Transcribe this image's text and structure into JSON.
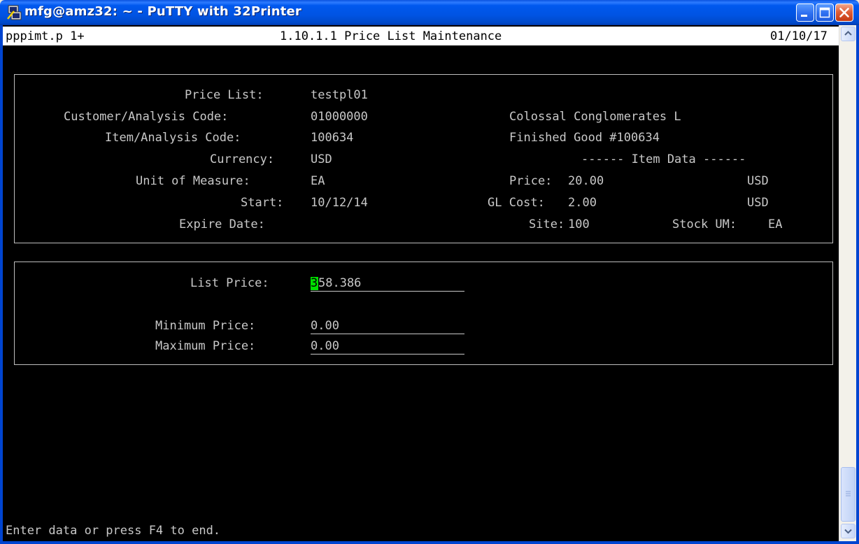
{
  "window": {
    "title": "mfg@amz32: ~ - PuTTY with 32Printer",
    "icon": "putty-icon",
    "controls": [
      "minimize-icon",
      "maximize-icon",
      "close-icon"
    ]
  },
  "header": {
    "program": "pppimt.p 1+",
    "menu_title": "1.10.1.1 Price List Maintenance",
    "date": "01/10/17"
  },
  "top_frame": {
    "fields": [
      {
        "label": "Price List:",
        "value": "testpl01"
      },
      {
        "label": "Customer/Analysis Code:",
        "value": "01000000"
      },
      {
        "label": "Item/Analysis Code:",
        "value": "100634"
      },
      {
        "label": "Currency:",
        "value": "USD"
      },
      {
        "label": "Unit of Measure:",
        "value": "EA"
      },
      {
        "label": "Start:",
        "value": "10/12/14"
      },
      {
        "label": "Expire Date:",
        "value": ""
      }
    ],
    "customer_name": "Colossal Conglomerates L",
    "item_description": "Finished Good #100634",
    "item_data_header": "------ Item Data ------",
    "price": {
      "label": "Price:",
      "value": "20.00",
      "currency": "USD"
    },
    "gl_cost": {
      "label": "GL Cost:",
      "value": "2.00",
      "currency": "USD"
    },
    "site": {
      "label": "Site:",
      "value": "100"
    },
    "stock_um": {
      "label": "Stock UM:",
      "value": "EA"
    }
  },
  "bottom_frame": {
    "list_price": {
      "label": "List Price:",
      "cursor_char": "3",
      "rest": "58.386"
    },
    "minimum_price": {
      "label": "Minimum Price:",
      "value": "0.00"
    },
    "maximum_price": {
      "label": "Maximum Price:",
      "value": "0.00"
    }
  },
  "status_line": "Enter data or press F4 to end.",
  "colors": {
    "terminal_bg": "#000000",
    "terminal_fg": "#C8C8C8",
    "header_bg": "#FFFFFF",
    "cursor": "#00E000",
    "titlebar": "#0054E3"
  }
}
